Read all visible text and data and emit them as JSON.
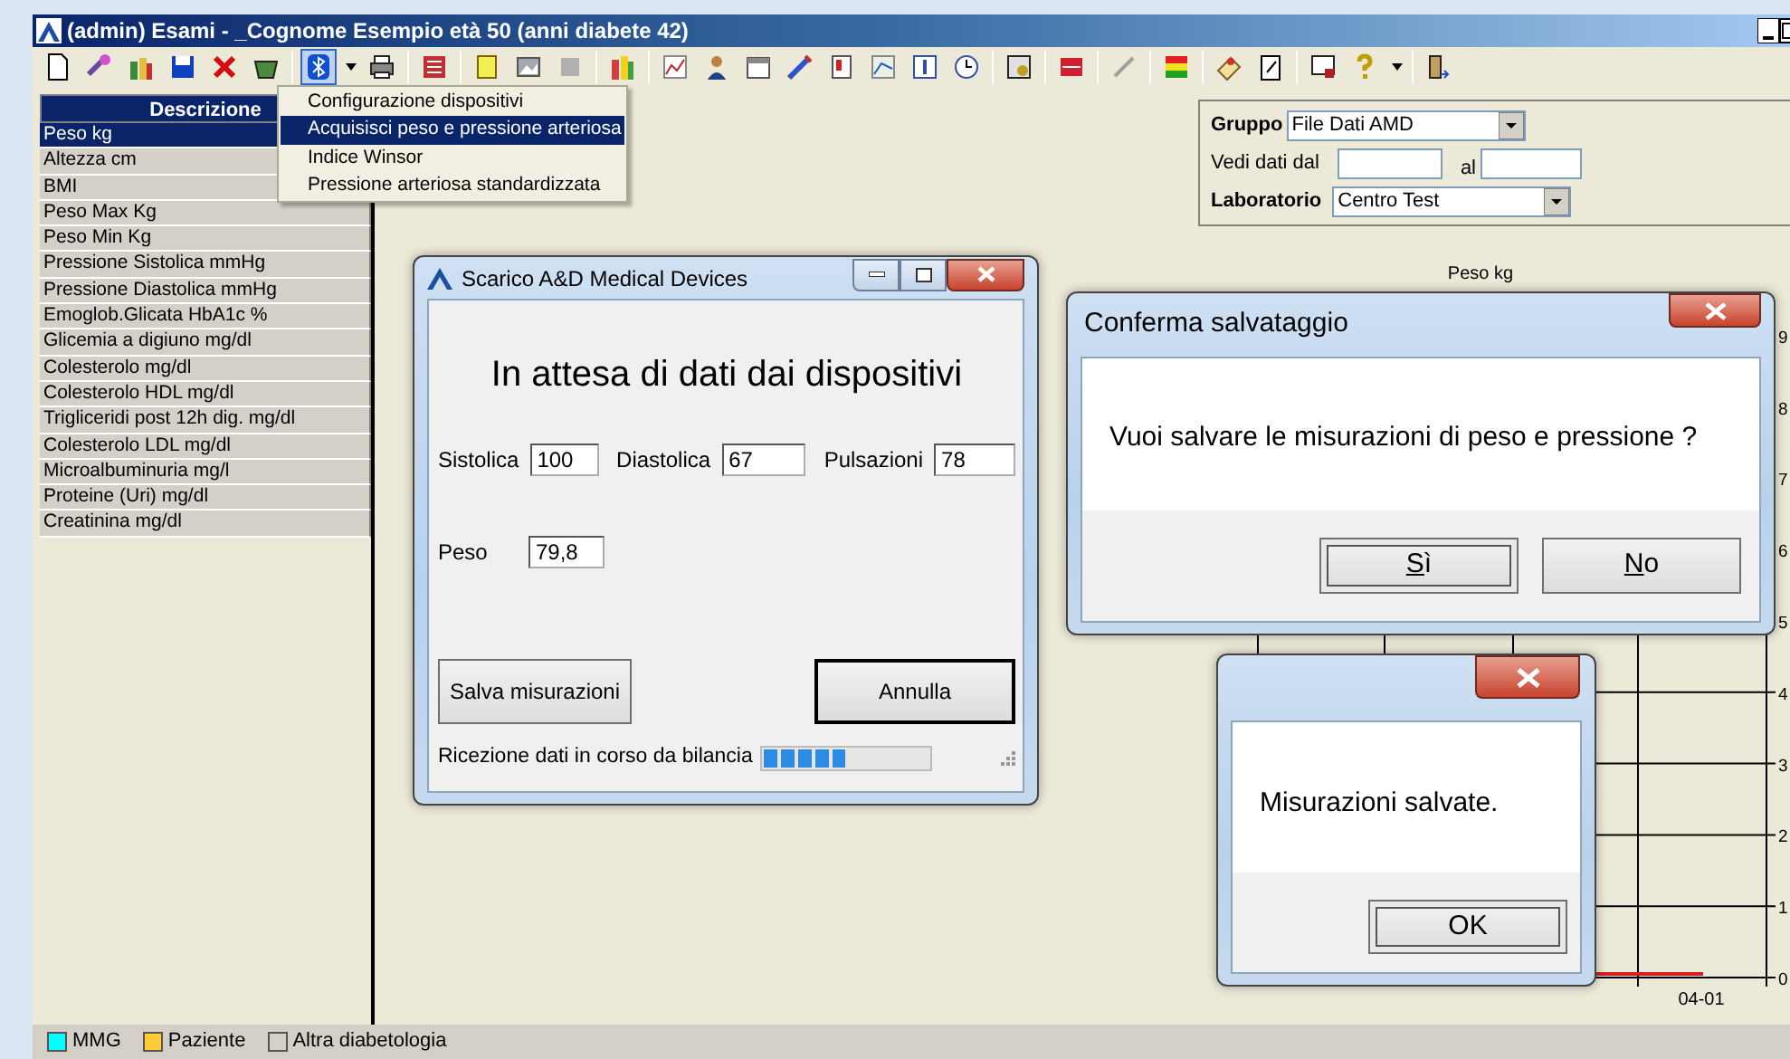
{
  "window": {
    "title": "(admin) Esami - _Cognome Esempio età 50 (anni diabete 42)"
  },
  "toolbar": [
    {
      "kind": "button",
      "selected": false
    },
    {
      "kind": "button",
      "selected": false
    },
    {
      "kind": "button",
      "selected": false
    },
    {
      "kind": "button",
      "selected": false
    },
    {
      "kind": "button",
      "selected": false
    },
    {
      "kind": "button",
      "selected": false
    },
    {
      "kind": "separator"
    },
    {
      "kind": "button",
      "selected": true
    },
    {
      "kind": "dropdown"
    },
    {
      "kind": "button",
      "selected": false
    },
    {
      "kind": "separator"
    },
    {
      "kind": "button",
      "selected": false
    },
    {
      "kind": "separator"
    },
    {
      "kind": "button",
      "selected": false
    },
    {
      "kind": "button",
      "selected": false
    },
    {
      "kind": "button",
      "selected": false
    },
    {
      "kind": "separator"
    },
    {
      "kind": "button",
      "selected": false
    },
    {
      "kind": "separator"
    },
    {
      "kind": "button",
      "selected": false
    },
    {
      "kind": "button",
      "selected": false
    },
    {
      "kind": "button",
      "selected": false
    },
    {
      "kind": "button",
      "selected": false
    },
    {
      "kind": "button",
      "selected": false
    },
    {
      "kind": "button",
      "selected": false
    },
    {
      "kind": "button",
      "selected": false
    },
    {
      "kind": "button",
      "selected": false
    },
    {
      "kind": "separator"
    },
    {
      "kind": "button",
      "selected": false
    },
    {
      "kind": "separator"
    },
    {
      "kind": "button",
      "selected": false
    },
    {
      "kind": "separator"
    },
    {
      "kind": "button",
      "selected": false
    },
    {
      "kind": "separator"
    },
    {
      "kind": "button",
      "selected": false
    },
    {
      "kind": "separator"
    },
    {
      "kind": "button",
      "selected": false
    },
    {
      "kind": "button",
      "selected": false
    },
    {
      "kind": "separator"
    },
    {
      "kind": "button",
      "selected": false
    },
    {
      "kind": "button",
      "selected": false
    },
    {
      "kind": "dropdown"
    },
    {
      "kind": "separator"
    },
    {
      "kind": "button",
      "selected": false
    }
  ],
  "device_menu": {
    "items": [
      {
        "label": "Configurazione dispositivi",
        "selected": false
      },
      {
        "label": "Acquisisci peso e pressione arteriosa",
        "selected": true
      },
      {
        "label": "Indice Winsor",
        "selected": false
      },
      {
        "label": "Pressione arteriosa standardizzata",
        "selected": false
      }
    ]
  },
  "exams": {
    "header": "Descrizione",
    "items": [
      {
        "label": "Peso kg",
        "selected": true
      },
      {
        "label": "Altezza cm",
        "selected": false
      },
      {
        "label": "BMI",
        "selected": false
      },
      {
        "label": "Peso Max Kg",
        "selected": false
      },
      {
        "label": "Peso Min Kg",
        "selected": false
      },
      {
        "label": "Pressione Sistolica mmHg",
        "selected": false
      },
      {
        "label": "Pressione Diastolica mmHg",
        "selected": false
      },
      {
        "label": "Emoglob.Glicata HbA1c %",
        "selected": false
      },
      {
        "label": "Glicemia a digiuno mg/dl",
        "selected": false
      },
      {
        "label": "Colesterolo mg/dl",
        "selected": false
      },
      {
        "label": "Colesterolo HDL mg/dl",
        "selected": false
      },
      {
        "label": "Trigliceridi post 12h dig. mg/dl",
        "selected": false
      },
      {
        "label": "Colesterolo LDL mg/dl",
        "selected": false
      },
      {
        "label": "Microalbuminuria mg/l",
        "selected": false
      },
      {
        "label": "Proteine (Uri) mg/dl",
        "selected": false
      },
      {
        "label": "Creatinina mg/dl",
        "selected": false
      }
    ]
  },
  "filters": {
    "group_label": "Gruppo",
    "group_value": "File Dati AMD",
    "from_label": "Vedi dati dal",
    "to_label": "al",
    "lab_label": "Laboratorio",
    "lab_value": "Centro Test"
  },
  "chart": {
    "title": "Peso kg",
    "y_labels": [
      "9",
      "8",
      "7",
      "6",
      "5",
      "4",
      "3",
      "2",
      "1",
      "0"
    ],
    "x_labels": [
      "04-01"
    ]
  },
  "legend": [
    {
      "label": "MMG",
      "color": "#00ffff"
    },
    {
      "label": "Paziente",
      "color": "#ffcc33"
    },
    {
      "label": "Altra diabetologia",
      "color": "#d4d0c8"
    }
  ],
  "download_dialog": {
    "title": "Scarico A&D Medical Devices",
    "heading": "In attesa di dati dai dispositivi",
    "fields": [
      {
        "label": "Sistolica",
        "value": "100"
      },
      {
        "label": "Diastolica",
        "value": "67"
      },
      {
        "label": "Pulsazioni",
        "value": "78"
      }
    ],
    "weight": {
      "label": "Peso",
      "value": "79,8"
    },
    "buttons": [
      {
        "label": "Salva misurazioni",
        "default": false
      },
      {
        "label": "Annulla",
        "default": true
      }
    ],
    "status": "Ricezione dati in corso da bilancia",
    "progress": {
      "level": 0.5
    }
  },
  "confirm_dialog": {
    "title": "Conferma salvataggio",
    "message": "Vuoi salvare le misurazioni di peso e pressione ?",
    "buttons": [
      {
        "label": "Sì",
        "focused": true
      },
      {
        "label": "No",
        "focused": false
      }
    ]
  },
  "saved_dialog": {
    "message": "Misurazioni salvate.",
    "buttons": [
      {
        "label": "OK",
        "focused": true
      }
    ]
  }
}
